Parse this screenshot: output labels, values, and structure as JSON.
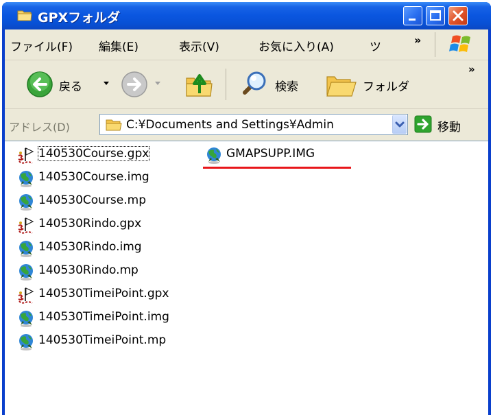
{
  "window": {
    "title": "GPXフォルダ",
    "colors": {
      "titlebar": "#0a56df",
      "close_button": "#e0542b",
      "highlight_underline": "#e8161a"
    }
  },
  "menubar": {
    "items": [
      "ファイル(F)",
      "編集(E)",
      "表示(V)",
      "お気に入り(A)",
      "ツ"
    ],
    "overflow": "»"
  },
  "toolbar": {
    "back_label": "戻る",
    "search_label": "検索",
    "folders_label": "フォルダ",
    "overflow": "»"
  },
  "addressbar": {
    "label": "アドレス(D)",
    "path": "C:¥Documents and Settings¥Admin",
    "go_label": "移動"
  },
  "files": [
    {
      "name": "140530Course.gpx",
      "icon": "gpx-flag-icon"
    },
    {
      "name": "140530Course.img",
      "icon": "map-globe-icon"
    },
    {
      "name": "140530Course.mp",
      "icon": "map-globe-icon"
    },
    {
      "name": "140530Rindo.gpx",
      "icon": "gpx-flag-icon"
    },
    {
      "name": "140530Rindo.img",
      "icon": "map-globe-icon"
    },
    {
      "name": "140530Rindo.mp",
      "icon": "map-globe-icon"
    },
    {
      "name": "140530TimeiPoint.gpx",
      "icon": "gpx-flag-icon"
    },
    {
      "name": "140530TimeiPoint.img",
      "icon": "map-globe-icon"
    },
    {
      "name": "140530TimeiPoint.mp",
      "icon": "map-globe-icon"
    },
    {
      "name": "GMAPSUPP.IMG",
      "icon": "map-globe-icon"
    }
  ]
}
